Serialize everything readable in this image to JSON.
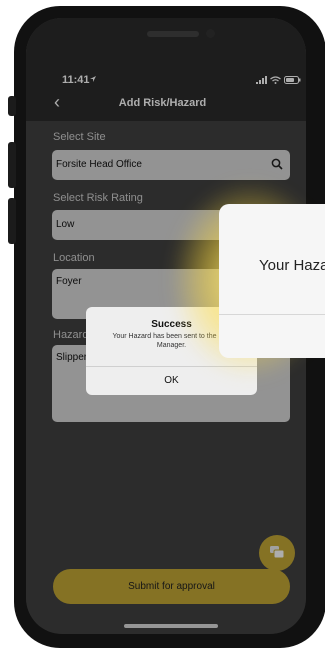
{
  "status_bar": {
    "time": "11:41"
  },
  "header": {
    "back_glyph": "‹",
    "title": "Add Risk/Hazard"
  },
  "form": {
    "site_label": "Select Site",
    "site_value": "Forsite Head Office",
    "rating_label": "Select Risk Rating",
    "rating_value": "Low",
    "location_label": "Location",
    "location_value": "Foyer",
    "hazard_label": "Hazard",
    "hazard_value": "Slippery floor"
  },
  "dialog": {
    "title": "Success",
    "message": "Your Hazard has been sent to the Site Manager.",
    "ok_label": "OK"
  },
  "zoom_callout": {
    "text": "Your Hazard has been sent to the Site Manager."
  },
  "footer": {
    "submit_label": "Submit for approval"
  },
  "colors": {
    "accent": "#c4a935",
    "background": "#424242",
    "field": "#d9d9d9"
  },
  "icons": [
    "location-arrow-icon",
    "signal-icon",
    "wifi-icon",
    "battery-icon",
    "back-chevron-icon",
    "search-icon",
    "chat-icon"
  ]
}
